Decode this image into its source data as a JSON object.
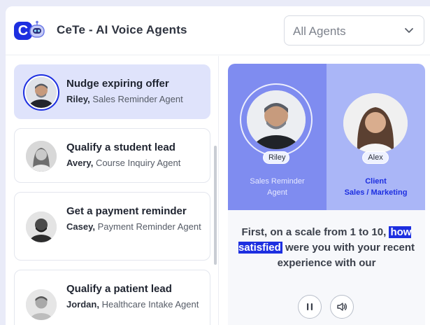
{
  "app": {
    "logo_letter": "C",
    "title": "CeTe - AI Voice Agents"
  },
  "header": {
    "agent_filter": {
      "selected": "All Agents"
    }
  },
  "agents": [
    {
      "title": "Nudge expiring offer",
      "name": "Riley,",
      "role": "Sales Reminder Agent",
      "active": true
    },
    {
      "title": "Qualify a student lead",
      "name": "Avery,",
      "role": "Course Inquiry Agent",
      "active": false
    },
    {
      "title": "Get a payment reminder",
      "name": "Casey,",
      "role": "Payment Reminder Agent",
      "active": false
    },
    {
      "title": "Qualify a patient lead",
      "name": "Jordan,",
      "role": "Healthcare Intake Agent",
      "active": false
    }
  ],
  "call": {
    "agent": {
      "name": "Riley",
      "role_line1": "Sales Reminder",
      "role_line2": "Agent"
    },
    "client": {
      "name": "Alex",
      "role_line1": "Client",
      "role_line2": "Sales / Marketing"
    },
    "transcript": {
      "before": "First, on a scale from 1 to 10,",
      "highlight": "how satisfied",
      "after": "were you with your recent experience with our"
    }
  },
  "colors": {
    "brand": "#1d2fe0",
    "agent_panel": "#7f8cf0",
    "client_panel": "#aab6f7",
    "active_card": "#dfe3fb"
  }
}
